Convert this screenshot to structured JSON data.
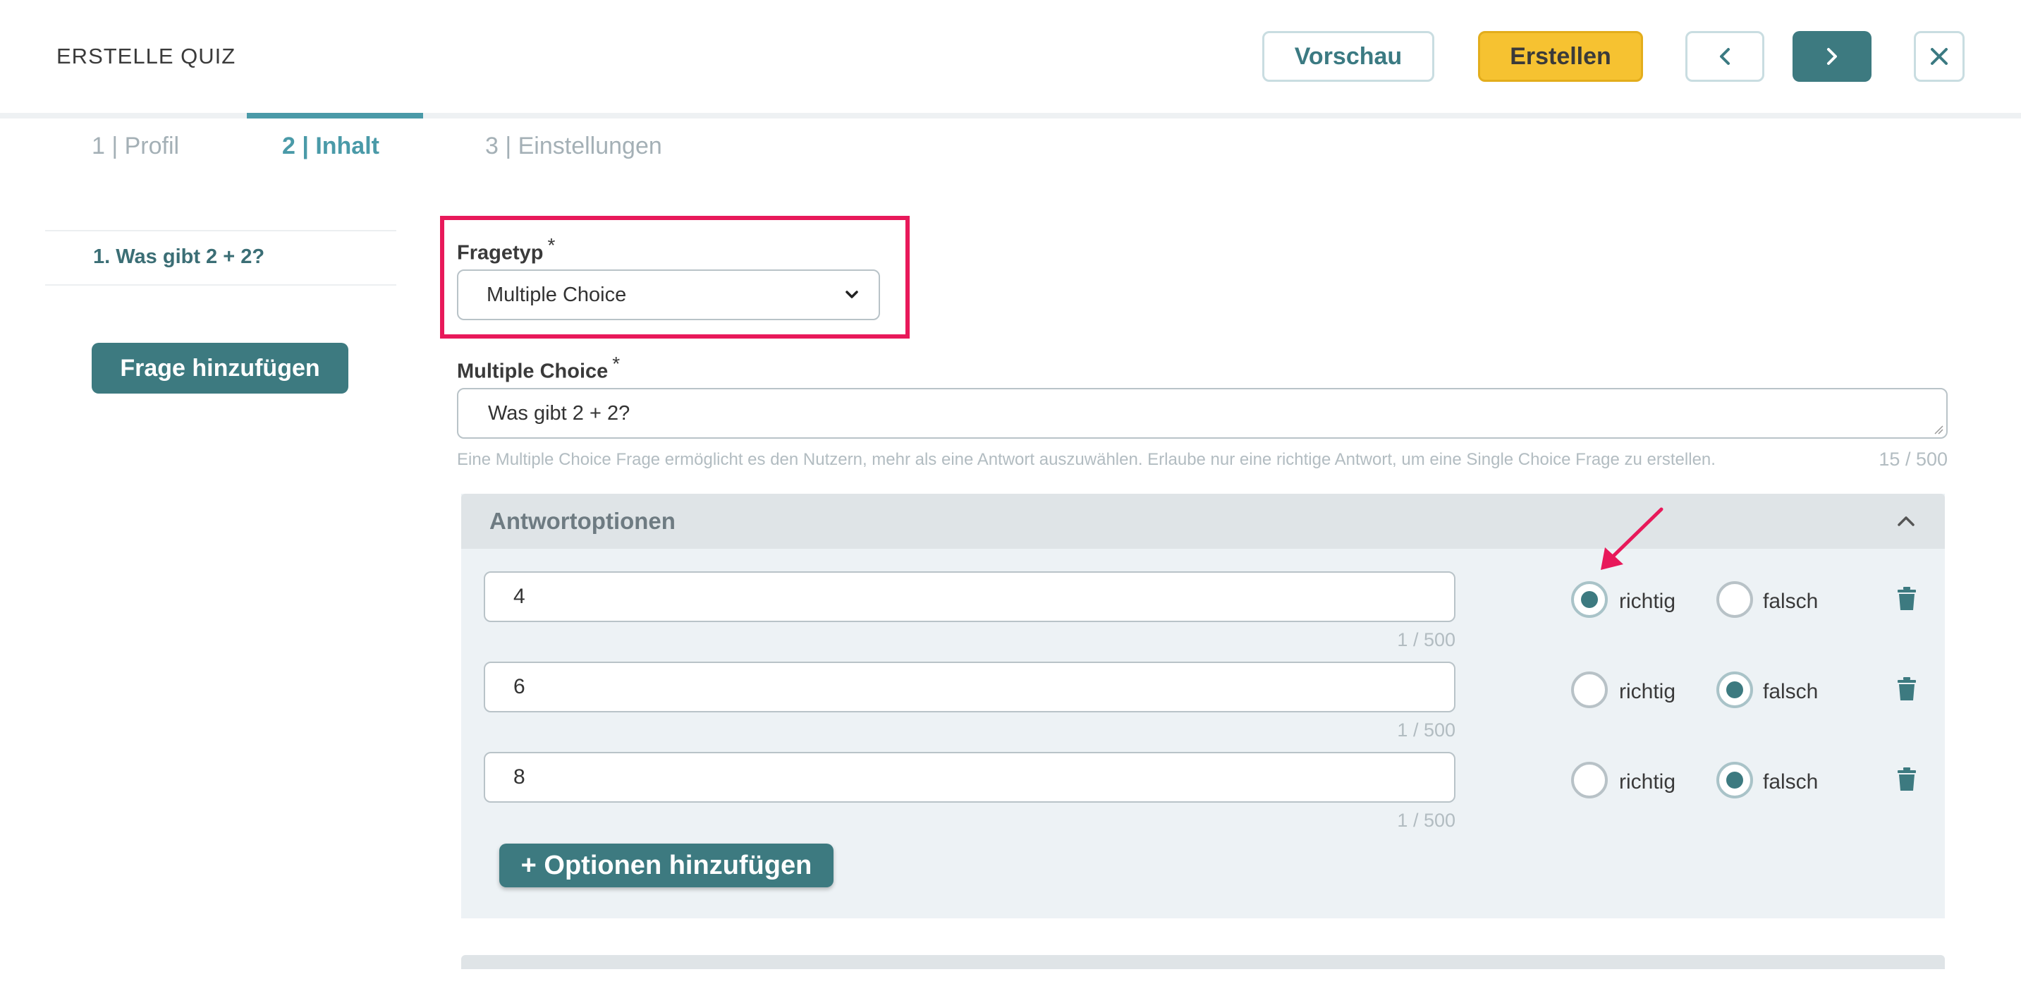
{
  "header": {
    "title": "ERSTELLE QUIZ",
    "preview_label": "Vorschau",
    "create_label": "Erstellen",
    "prev_icon": "chevron-left-icon",
    "next_icon": "chevron-right-icon",
    "close_icon": "close-icon"
  },
  "tabs": [
    {
      "label": "1 | Profil",
      "active": false
    },
    {
      "label": "2 | Inhalt",
      "active": true
    },
    {
      "label": "3 | Einstellungen",
      "active": false
    }
  ],
  "sidebar": {
    "questions": [
      "1. Was gibt 2 + 2?"
    ],
    "add_question_label": "Frage hinzufügen"
  },
  "form": {
    "question_type_label": "Fragetyp",
    "required_mark": "*",
    "question_type_value": "Multiple Choice",
    "question_label": "Multiple Choice",
    "question_value": "Was gibt 2 + 2?",
    "hint": "Eine Multiple Choice Frage ermöglicht es den Nutzern, mehr als eine Antwort auszuwählen. Erlaube nur eine richtige Antwort, um eine Single Choice Frage zu erstellen.",
    "question_counter": "15 / 500"
  },
  "answers": {
    "title": "Antwortoptionen",
    "correct_label": "richtig",
    "wrong_label": "falsch",
    "options": [
      {
        "value": "4",
        "counter": "1 / 500",
        "correct": true
      },
      {
        "value": "6",
        "counter": "1 / 500",
        "correct": false
      },
      {
        "value": "8",
        "counter": "1 / 500",
        "correct": false
      }
    ],
    "add_option_label": "+ Optionen hinzufügen"
  },
  "colors": {
    "accent": "#3d7a80",
    "tab_active": "#4a9aa8",
    "create_button": "#f6c231",
    "annotation": "#e8195a"
  }
}
